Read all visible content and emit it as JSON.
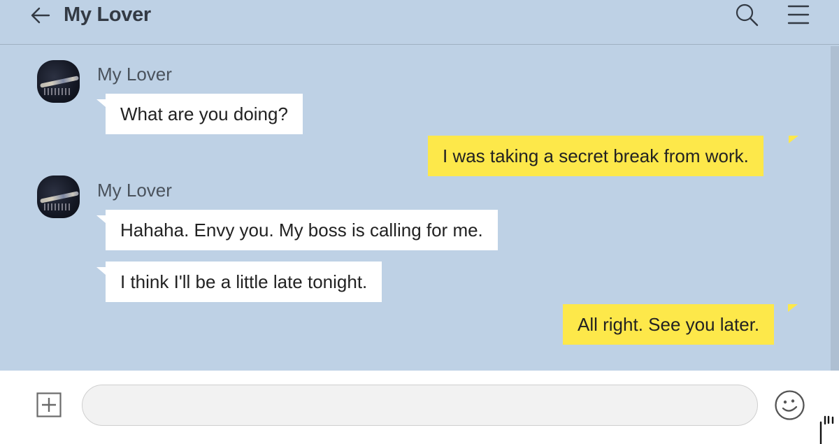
{
  "header": {
    "title": "My Lover",
    "icons": {
      "back": "back-arrow-icon",
      "search": "search-icon",
      "menu": "menu-icon"
    }
  },
  "messages": [
    {
      "direction": "incoming",
      "sender": "My Lover",
      "texts": [
        "What are you doing?"
      ]
    },
    {
      "direction": "outgoing",
      "texts": [
        "I was taking a secret break from work."
      ]
    },
    {
      "direction": "incoming",
      "sender": "My Lover",
      "texts": [
        "Hahaha. Envy you. My boss is calling for me.",
        "I think I'll be a little late tonight."
      ]
    },
    {
      "direction": "outgoing",
      "texts": [
        "All right. See you later."
      ]
    }
  ],
  "composer": {
    "value": "",
    "icons": {
      "attach": "plus-icon",
      "emoji": "emoji-icon"
    }
  },
  "colors": {
    "chat_background": "#bed1e5",
    "incoming_bubble": "#ffffff",
    "outgoing_bubble": "#fde84a",
    "composer_background": "#ffffff"
  }
}
